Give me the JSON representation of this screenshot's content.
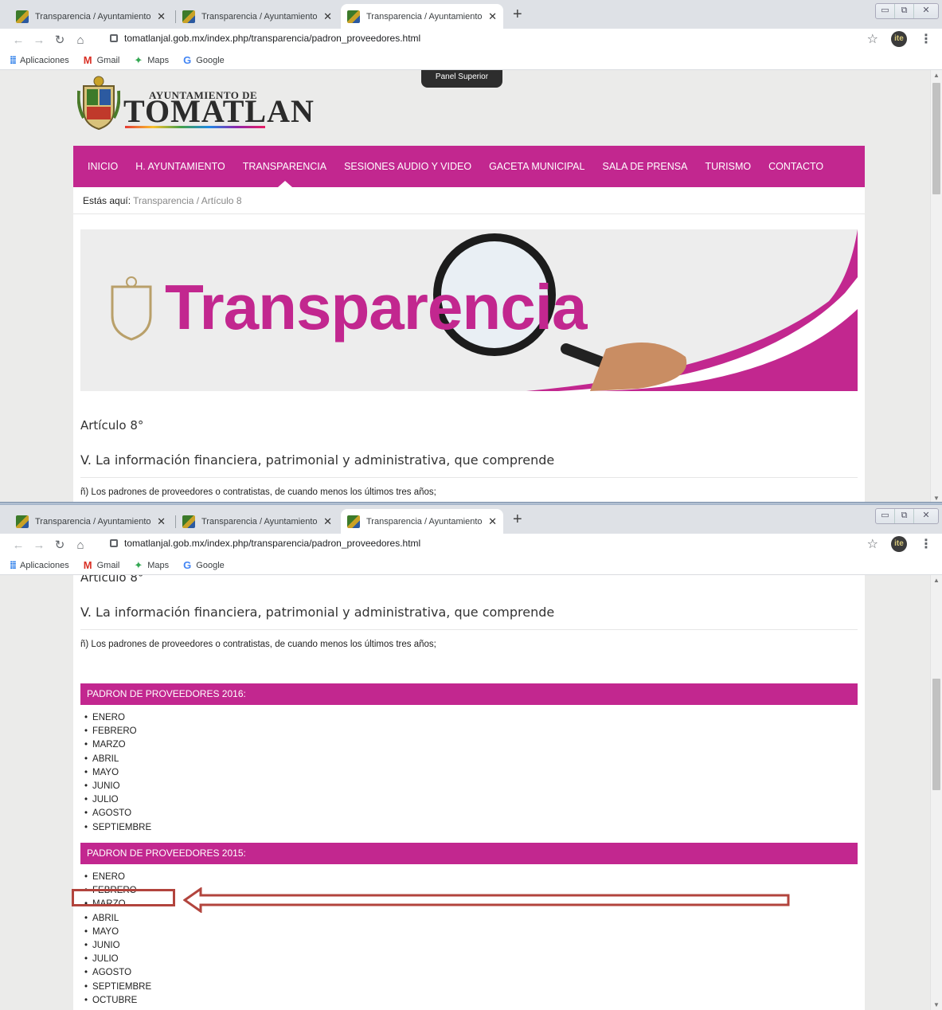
{
  "browser": {
    "tabs": [
      {
        "title": "Transparencia / Ayuntamiento de"
      },
      {
        "title": "Transparencia / Ayuntamiento de"
      },
      {
        "title": "Transparencia / Ayuntamiento de"
      }
    ],
    "url": "tomatlanjal.gob.mx/index.php/transparencia/padron_proveedores.html",
    "profile_initials": "ite",
    "bookmarks": [
      "Aplicaciones",
      "Gmail",
      "Maps",
      "Google"
    ]
  },
  "site": {
    "logo_sub": "AYUNTAMIENTO DE",
    "logo_main": "TOMATLAN",
    "panel_superior": "Panel Superior",
    "nav": [
      "INICIO",
      "H. AYUNTAMIENTO",
      "TRANSPARENCIA",
      "SESIONES AUDIO Y VIDEO",
      "GACETA MUNICIPAL",
      "SALA DE PRENSA",
      "TURISMO",
      "CONTACTO"
    ],
    "nav_active_index": 2,
    "breadcrumb": {
      "label": "Estás aquí:",
      "items": [
        "Transparencia",
        "Artículo 8"
      ],
      "separator": "/"
    },
    "banner_text": "Transparencia",
    "accent_color": "#c2278f"
  },
  "content": {
    "article_title": "Artículo 8°",
    "section_title": "V. La información financiera, patrimonial y administrativa, que comprende",
    "description": "ñ) Los padrones de proveedores o contratistas, de cuando menos los últimos tres años;",
    "padron_2016": {
      "header": "PADRON DE PROVEEDORES 2016:",
      "months": [
        "ENERO",
        "FEBRERO",
        "MARZO",
        "ABRIL",
        "MAYO",
        "JUNIO",
        "JULIO",
        "AGOSTO",
        "SEPTIEMBRE"
      ]
    },
    "padron_2015": {
      "header": "PADRON DE PROVEEDORES 2015:",
      "months": [
        "ENERO",
        "FEBRERO",
        "MARZO",
        "ABRIL",
        "MAYO",
        "JUNIO",
        "JULIO",
        "AGOSTO",
        "SEPTIEMBRE",
        "OCTUBRE"
      ]
    }
  },
  "annotation": {
    "highlighted_item": "SEPTIEMBRE",
    "color": "#b2443d"
  }
}
